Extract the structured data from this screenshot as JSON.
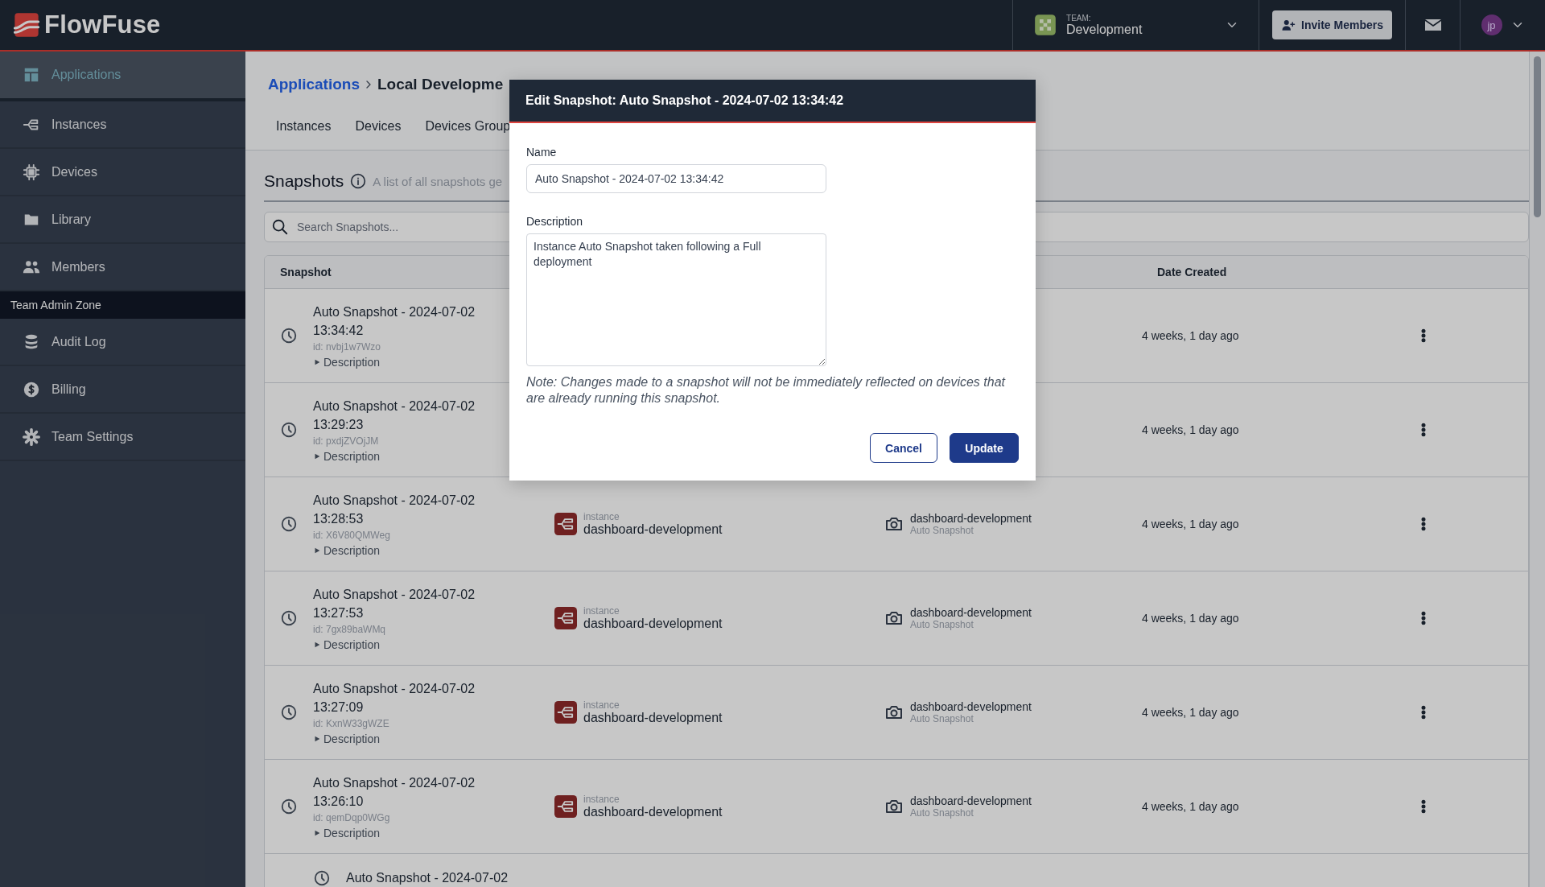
{
  "header": {
    "brand": "FlowFuse",
    "team": {
      "label": "TEAM:",
      "name": "Development"
    },
    "invite_button": "Invite Members",
    "user_initials": "jp"
  },
  "sidebar": {
    "items": [
      {
        "label": "Applications",
        "selected": true
      },
      {
        "label": "Instances",
        "selected": false
      },
      {
        "label": "Devices",
        "selected": false
      },
      {
        "label": "Library",
        "selected": false
      },
      {
        "label": "Members",
        "selected": false
      }
    ],
    "admin_section": {
      "title": "Team Admin Zone",
      "items": [
        {
          "label": "Audit Log",
          "selected": false
        },
        {
          "label": "Billing",
          "selected": false
        },
        {
          "label": "Team Settings",
          "selected": false
        }
      ]
    }
  },
  "breadcrumb": {
    "parent": "Applications",
    "current": "Local Developme"
  },
  "tabs": [
    {
      "label": "Instances",
      "selected": false
    },
    {
      "label": "Devices",
      "selected": false
    },
    {
      "label": "Devices Group",
      "selected": false
    }
  ],
  "snapshots": {
    "title": "Snapshots",
    "subtitle": "A list of all snapshots ge",
    "search_placeholder": "Search Snapshots...",
    "columns": [
      "Snapshot",
      "Date Created"
    ],
    "rows": [
      {
        "name": "Auto Snapshot - 2024-07-02 13:34:42",
        "id": "id: nvbj1w7Wzo",
        "details": "Description",
        "date": "4 weeks, 1 day ago"
      },
      {
        "name": "Auto Snapshot - 2024-07-02 13:29:23",
        "id": "id: pxdjZVOjJM",
        "details": "Description",
        "date": "4 weeks, 1 day ago"
      },
      {
        "name": "Auto Snapshot - 2024-07-02 13:28:53",
        "id": "id: X6V80QMWeg",
        "details": "Description",
        "instance": {
          "label": "instance",
          "name": "dashboard-development"
        },
        "source": {
          "name": "dashboard-development",
          "sub": "Auto Snapshot"
        },
        "date": "4 weeks, 1 day ago"
      },
      {
        "name": "Auto Snapshot - 2024-07-02 13:27:53",
        "id": "id: 7gx89baWMq",
        "details": "Description",
        "instance": {
          "label": "instance",
          "name": "dashboard-development"
        },
        "source": {
          "name": "dashboard-development",
          "sub": "Auto Snapshot"
        },
        "date": "4 weeks, 1 day ago"
      },
      {
        "name": "Auto Snapshot - 2024-07-02 13:27:09",
        "id": "id: KxnW33gWZE",
        "details": "Description",
        "instance": {
          "label": "instance",
          "name": "dashboard-development"
        },
        "source": {
          "name": "dashboard-development",
          "sub": "Auto Snapshot"
        },
        "date": "4 weeks, 1 day ago"
      },
      {
        "name": "Auto Snapshot - 2024-07-02 13:26:10",
        "id": "id: qemDqp0WGg",
        "details": "Description",
        "instance": {
          "label": "instance",
          "name": "dashboard-development"
        },
        "source": {
          "name": "dashboard-development",
          "sub": "Auto Snapshot"
        },
        "date": "4 weeks, 1 day ago"
      },
      {
        "name": "Auto Snapshot - 2024-07-02"
      }
    ]
  },
  "dialog": {
    "title": "Edit Snapshot: Auto Snapshot - 2024-07-02 13:34:42",
    "name_label": "Name",
    "name_value": "Auto Snapshot - 2024-07-02 13:34:42",
    "description_label": "Description",
    "description_value": "Instance Auto Snapshot taken following a Full deployment",
    "note": "Note: Changes made to a snapshot will not be immediately reflected on devices that are already running this snapshot.",
    "buttons": [
      {
        "label": "Cancel",
        "kind": "secondary"
      },
      {
        "label": "Update",
        "kind": "primary"
      }
    ]
  }
}
